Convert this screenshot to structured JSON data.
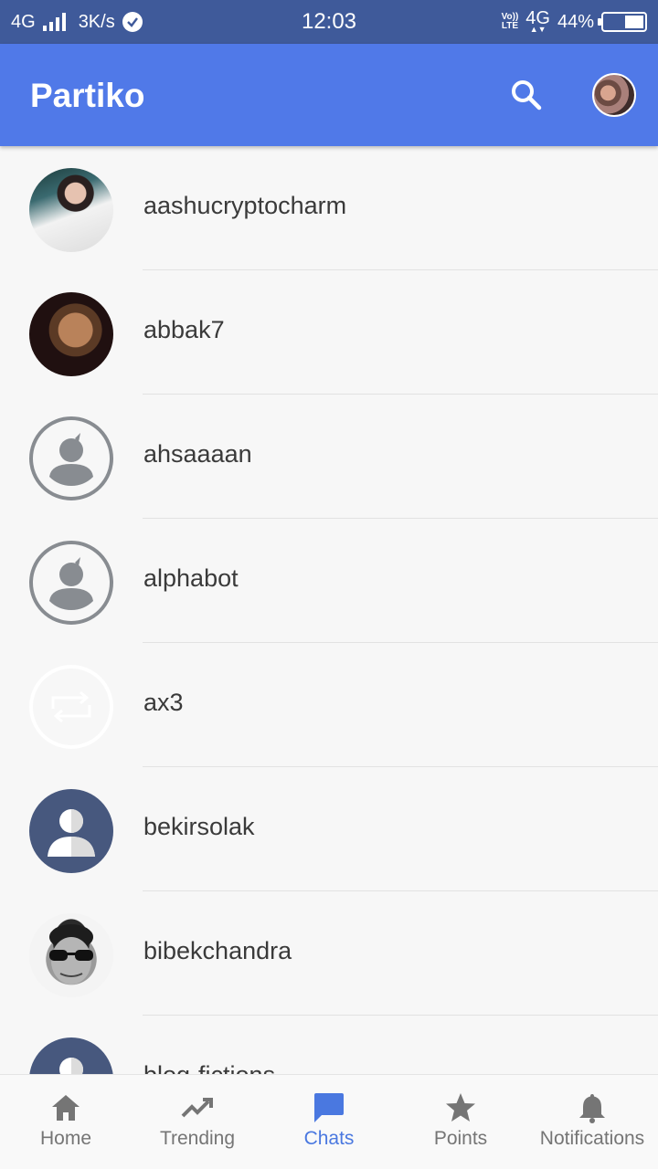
{
  "status_bar": {
    "network_left": "4G",
    "speed": "3K/s",
    "time": "12:03",
    "volte_top": "Vo))",
    "volte_bottom": "LTE",
    "network_right": "4G",
    "battery": "44%",
    "battery_level": 0.44
  },
  "app_bar": {
    "title": "Partiko",
    "search_icon": "search-icon",
    "avatar": "profile-avatar"
  },
  "chats": [
    {
      "name": "aashucryptocharm",
      "avatar": "photo"
    },
    {
      "name": "abbak7",
      "avatar": "photo"
    },
    {
      "name": "ahsaaaan",
      "avatar": "default-outline"
    },
    {
      "name": "alphabot",
      "avatar": "default-outline"
    },
    {
      "name": "ax3",
      "avatar": "blank-repost"
    },
    {
      "name": "bekirsolak",
      "avatar": "default-navy"
    },
    {
      "name": "bibekchandra",
      "avatar": "photo"
    },
    {
      "name": "blog-fictions",
      "avatar": "default-navy"
    }
  ],
  "bottom_nav": {
    "active": "Chats",
    "items": [
      {
        "label": "Home",
        "icon": "home-icon"
      },
      {
        "label": "Trending",
        "icon": "trending-icon"
      },
      {
        "label": "Chats",
        "icon": "chat-icon"
      },
      {
        "label": "Points",
        "icon": "star-icon"
      },
      {
        "label": "Notifications",
        "icon": "bell-icon"
      }
    ]
  },
  "colors": {
    "status_bar": "#3f5a9a",
    "app_bar": "#5079e8",
    "active_tab": "#4a78e0",
    "inactive_tab": "#757575"
  }
}
